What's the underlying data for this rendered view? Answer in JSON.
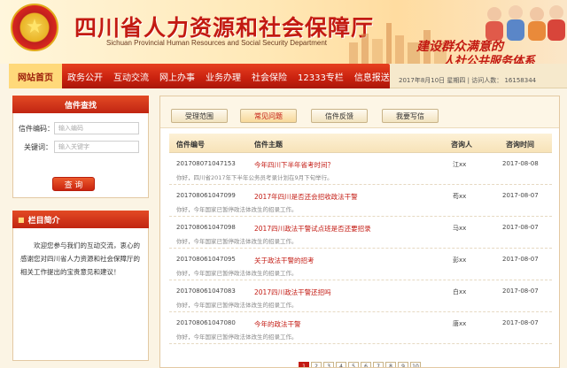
{
  "header": {
    "title": "四川省人力资源和社会保障厅",
    "subtitle": "Sichuan Provincial Human Resources and Social Security Department",
    "slogan_line1": "建设群众满意的",
    "slogan_line2": "人社公共服务体系"
  },
  "nav": {
    "items": [
      "网站首页",
      "政务公开",
      "互动交流",
      "网上办事",
      "业务办理",
      "社会保险",
      "12333专栏",
      "信息报送"
    ]
  },
  "status": {
    "date": "2017年8月10日 星期四",
    "visitors_label": "访问人数：",
    "visitors_count": "16158344"
  },
  "search": {
    "title": "信件查找",
    "id_label": "信件编码：",
    "id_placeholder": "输入编码",
    "keyword_label": "关键词：",
    "keyword_placeholder": "输入关键字",
    "button_label": "查 询"
  },
  "intro": {
    "title": "栏目简介",
    "text": "欢迎您参与我们的互动交流，衷心的感谢您对四川省人力资源和社会保障厅的相关工作提出的宝贵意见和建议！"
  },
  "tabs": [
    "受理范围",
    "常见问题",
    "信件反馈",
    "我要写信"
  ],
  "table": {
    "headers": [
      "信件编号",
      "信件主题",
      "咨询人",
      "咨询时间"
    ],
    "rows": [
      {
        "id": "201708071047153",
        "subject": "今年四川下半年省考时间？",
        "user": "江xx",
        "date": "2017-08-08",
        "snippet": "你好，四川省2017年下半年公务员考录计划在9月下旬举行。"
      },
      {
        "id": "201708061047099",
        "subject": "2017年四川是否还会招收政法干警",
        "user": "苟xx",
        "date": "2017-08-07",
        "snippet": "你好，今年国家已暂停政法体改生的招录工作。"
      },
      {
        "id": "201708061047098",
        "subject": "2017四川政法干警试点班是否还要招录",
        "user": "马xx",
        "date": "2017-08-07",
        "snippet": "你好，今年国家已暂停政法体改生的招录工作。"
      },
      {
        "id": "201708061047095",
        "subject": "关于政法干警的招考",
        "user": "彭xx",
        "date": "2017-08-07",
        "snippet": "你好，今年国家已暂停政法体改生的招录工作。"
      },
      {
        "id": "201708061047083",
        "subject": "2017四川政法干警还招吗",
        "user": "白xx",
        "date": "2017-08-07",
        "snippet": "你好，今年国家已暂停政法体改生的招录工作。"
      },
      {
        "id": "201708061047080",
        "subject": "今年的政法干警",
        "user": "唐xx",
        "date": "2017-08-07",
        "snippet": "你好，今年国家已暂停政法体改生的招录工作。"
      }
    ]
  },
  "pager": [
    "1",
    "2",
    "3",
    "4",
    "5",
    "6",
    "7",
    "8",
    "9",
    "10"
  ]
}
